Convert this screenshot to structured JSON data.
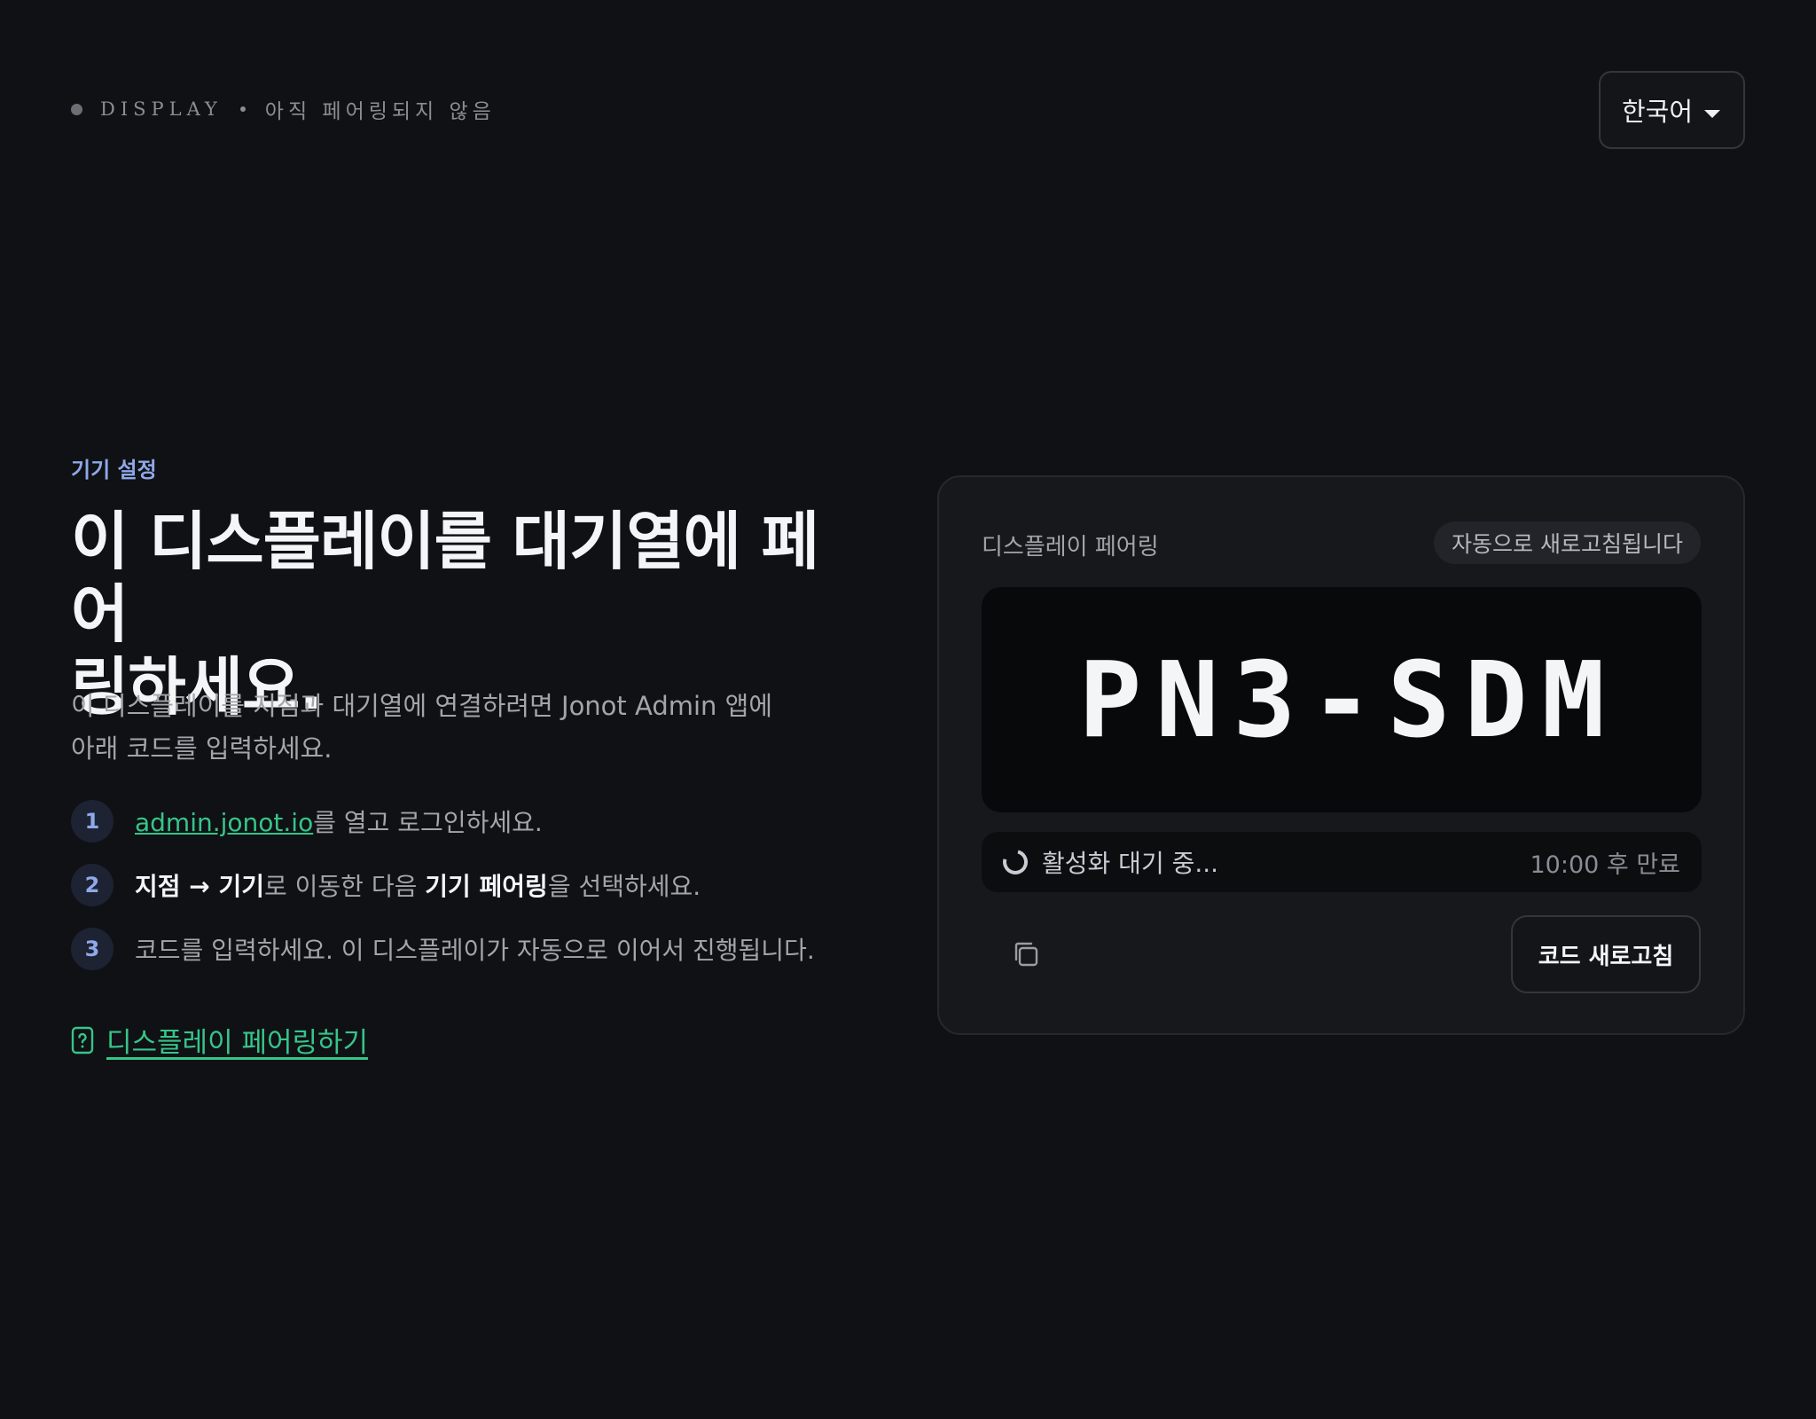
{
  "status": {
    "tag": "DISPLAY",
    "state": "아직 페어링되지 않음"
  },
  "language": {
    "selected": "한국어"
  },
  "intro": {
    "eyebrow": "기기 설정",
    "headline_line1": "이 디스플레이를 대기열에 페어",
    "headline_line2": "링하세요.",
    "lead_line1": "이 디스플레이를 지점과 대기열에 연결하려면 Jonot Admin 앱에",
    "lead_line2": "아래 코드를 입력하세요."
  },
  "steps": [
    {
      "num": "1",
      "link": "admin.jonot.io",
      "rest": "를 열고 로그인하세요."
    },
    {
      "num": "2",
      "bold1": "지점 → 기기",
      "mid": "로 이동한 다음 ",
      "bold2": "기기 페어링",
      "rest": "을 선택하세요."
    },
    {
      "num": "3",
      "text": "코드를 입력하세요. 이 디스플레이가 자동으로 이어서 진행됩니다."
    }
  ],
  "help": {
    "label": "디스플레이 페어링하기",
    "icon": "help-doc-icon"
  },
  "card": {
    "title": "디스플레이 페어링",
    "auto_refresh": "자동으로 새로고침됩니다",
    "code": "PN3-SDM",
    "waiting": "활성화 대기 중...",
    "expires": "10:00 후 만료",
    "refresh_button": "코드 새로고침",
    "copy_icon": "copy-icon"
  },
  "colors": {
    "background": "#101114",
    "accent_blue": "#8fa8ea",
    "link_green": "#36c58a",
    "card": "#17181c"
  }
}
